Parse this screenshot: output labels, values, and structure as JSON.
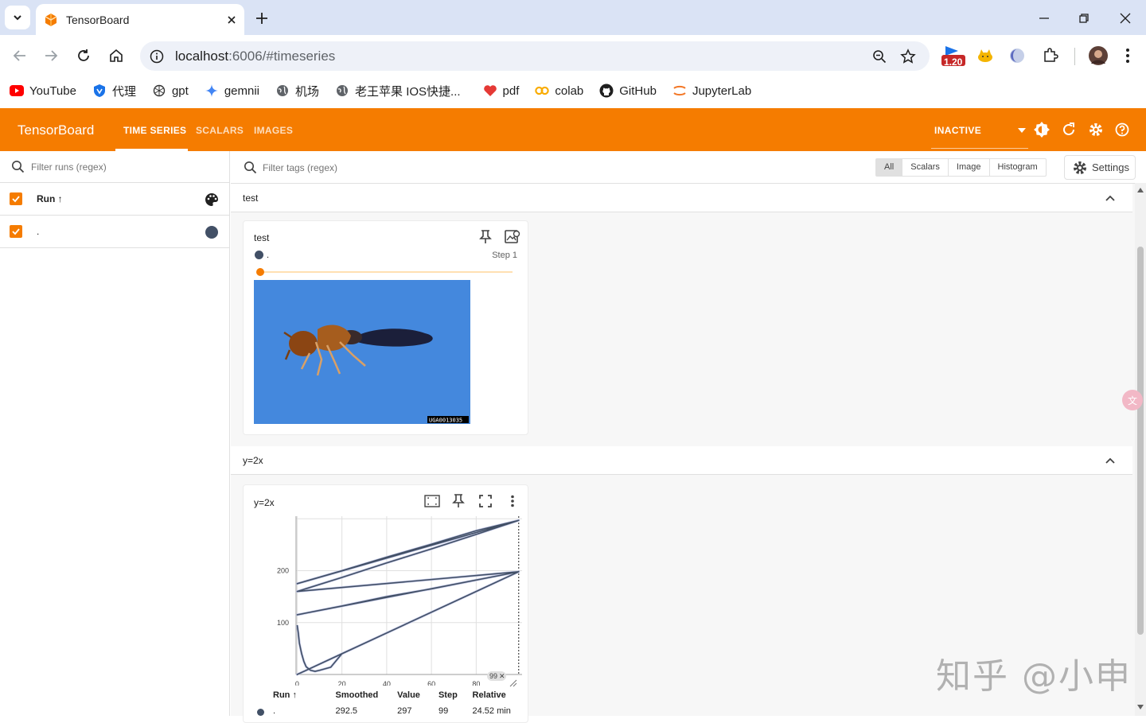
{
  "browser": {
    "tab_title": "TensorBoard",
    "url_host": "localhost",
    "url_rest": ":6006/#timeseries",
    "extension_badge": "1.20",
    "bookmarks": [
      {
        "label": "YouTube",
        "icon": "youtube-icon"
      },
      {
        "label": "代理",
        "icon": "shield-icon"
      },
      {
        "label": "gpt",
        "icon": "openai-icon"
      },
      {
        "label": "gemnii",
        "icon": "gemini-star-icon"
      },
      {
        "label": "机场",
        "icon": "globe-icon"
      },
      {
        "label": "老王苹果 IOS快捷...",
        "icon": "globe-icon"
      },
      {
        "label": "pdf",
        "icon": "heart-icon"
      },
      {
        "label": "colab",
        "icon": "colab-icon"
      },
      {
        "label": "GitHub",
        "icon": "github-icon"
      },
      {
        "label": "JupyterLab",
        "icon": "jupyter-icon"
      }
    ]
  },
  "tensorboard": {
    "brand": "TensorBoard",
    "tabs": [
      "TIME SERIES",
      "SCALARS",
      "IMAGES"
    ],
    "active_tab": "TIME SERIES",
    "status": "INACTIVE",
    "accent_color": "#f57c00"
  },
  "sidebar": {
    "filter_placeholder": "Filter runs (regex)",
    "header_label": "Run ↑",
    "runs": [
      {
        "name": ".",
        "color": "#425066"
      }
    ]
  },
  "main": {
    "filter_placeholder": "Filter tags (regex)",
    "type_filters": [
      "All",
      "Scalars",
      "Image",
      "Histogram"
    ],
    "selected_type": "All",
    "settings_label": "Settings",
    "groups": [
      {
        "name": "test",
        "card": {
          "title": "test",
          "run": ".",
          "step_label": "Step 1",
          "image_caption": "UGA0013035"
        }
      },
      {
        "name": "y=2x",
        "card": {
          "title": "y=2x",
          "x_marker": "99",
          "table": {
            "headers": [
              "Run ↑",
              "Smoothed",
              "Value",
              "Step",
              "Relative"
            ],
            "row": {
              "run": ".",
              "smoothed": "292.5",
              "value": "297",
              "step": "99",
              "relative": "24.52 min"
            }
          }
        }
      }
    ]
  },
  "chart_data": {
    "type": "line",
    "title": "y=2x",
    "xlabel": "",
    "ylabel": "",
    "x_ticks": [
      "0",
      "20",
      "40",
      "60",
      "80"
    ],
    "y_ticks": [
      "100",
      "200"
    ],
    "xlim": [
      -0.5,
      100.5
    ],
    "ylim": [
      0,
      305
    ],
    "grid": true,
    "series": [
      {
        "color": "#425066",
        "x": [
          0,
          0.5,
          1,
          2,
          3,
          4,
          6,
          8,
          10,
          15,
          20,
          40,
          60,
          80,
          99,
          0,
          20,
          40,
          60,
          80,
          99,
          0,
          20,
          40,
          60,
          80,
          99,
          0,
          20,
          40,
          60,
          80,
          99,
          0,
          20,
          40,
          60,
          80,
          99
        ],
        "y": [
          95,
          80,
          60,
          40,
          25,
          15,
          8,
          6,
          8,
          14,
          40,
          80,
          120,
          160,
          198,
          0,
          40,
          80,
          120,
          160,
          198,
          115,
          132,
          150,
          165,
          182,
          198,
          160,
          187,
          215,
          242,
          270,
          297,
          175,
          200,
          226,
          251,
          277,
          297
        ]
      }
    ]
  },
  "watermark": "知乎 @小申"
}
